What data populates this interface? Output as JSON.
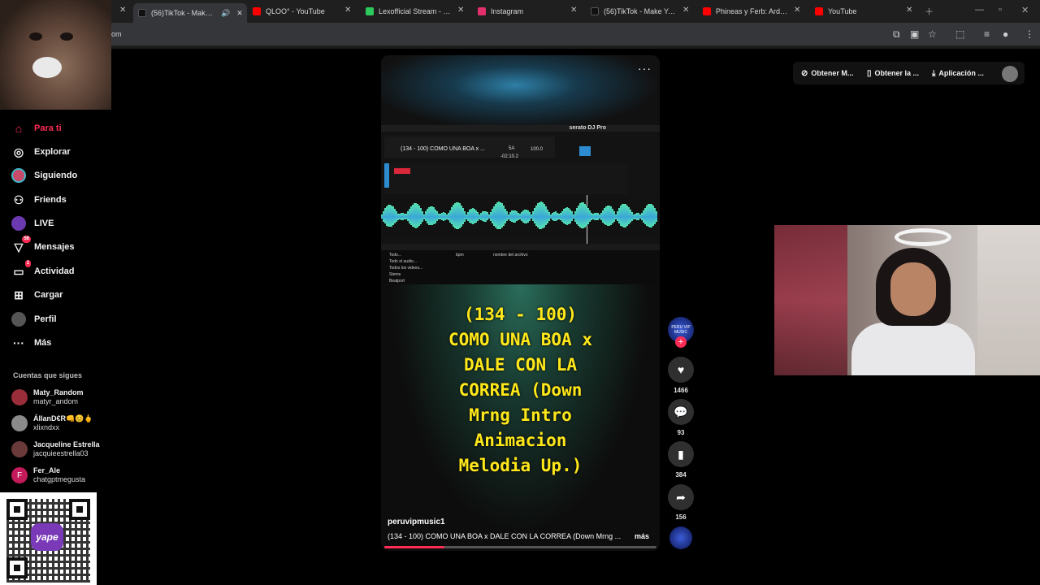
{
  "browser": {
    "tabs": [
      {
        "label": "(56)TikTok - Make You",
        "fav": "#111111",
        "active": true
      },
      {
        "label": "QLOO° - YouTube",
        "fav": "#ff0000"
      },
      {
        "label": "Lexofficial Stream - Watch",
        "fav": "#2ec95c"
      },
      {
        "label": "Instagram",
        "fav": "#e1306c"
      },
      {
        "label": "(56)TikTok - Make Your D",
        "fav": "#111111"
      },
      {
        "label": "Phineas y Ferb: Ardillas p",
        "fav": "#ff0000"
      },
      {
        "label": "YouTube",
        "fav": "#ff0000"
      }
    ],
    "url_fragment": "om"
  },
  "sidebar": {
    "items": [
      {
        "label": "Para ti",
        "icon": "home-icon",
        "glyph": "⌂"
      },
      {
        "label": "Explorar",
        "icon": "compass-icon",
        "glyph": "◎"
      },
      {
        "label": "Siguiendo",
        "icon": "following-avatar-icon",
        "glyph": ""
      },
      {
        "label": "Friends",
        "icon": "friends-icon",
        "glyph": "⚇"
      },
      {
        "label": "LIVE",
        "icon": "live-avatar-icon",
        "glyph": ""
      },
      {
        "label": "Mensajes",
        "icon": "messages-icon",
        "glyph": "✈",
        "badge": "56"
      },
      {
        "label": "Actividad",
        "icon": "activity-icon",
        "glyph": "▭",
        "badge": "1"
      },
      {
        "label": "Cargar",
        "icon": "upload-icon",
        "glyph": "⊞"
      },
      {
        "label": "Perfil",
        "icon": "profile-avatar-icon",
        "glyph": ""
      },
      {
        "label": "Más",
        "icon": "more-icon",
        "glyph": "···"
      }
    ],
    "following_title": "Cuentas que sigues",
    "following": [
      {
        "name": "Maty_Random",
        "user": "matyr_andom"
      },
      {
        "name": "ÁllanD€R👊😊🖕",
        "user": "xlixndxx"
      },
      {
        "name": "Jacqueline Estrella",
        "user": "jacquieestrella03"
      },
      {
        "name": "Fer_Ale",
        "user": "chatgptmegusta",
        "initial": "F"
      }
    ],
    "qr_logo": "yape"
  },
  "header": {
    "btn1": "Obtener M...",
    "btn2": "Obtener la ...",
    "btn3": "Aplicación ..."
  },
  "video": {
    "more": "···",
    "overlay_lines": [
      "(134 - 100)",
      "COMO UNA BOA x",
      "DALE CON LA",
      "CORREA (Down",
      "Mrng Intro",
      "Animacion",
      "Melodia Up.)"
    ],
    "author": "peruvipmusic1",
    "description": "(134 - 100) COMO UNA BOA x DALE CON LA CORREA (Down Mrng ...",
    "more_link": "más",
    "progress_percent": 22,
    "serato": {
      "brand": "serato DJ Pro",
      "track": "(134 - 100) COMO UNA BOA x ...",
      "key": "5A",
      "bpm": "100.0",
      "time": "-02:10.2",
      "library_items": [
        "Todo...",
        "Todo el audio...",
        "Todos los videos...",
        "Stems",
        "Beatport"
      ],
      "library_cols": [
        "bpm",
        "nombre del archivo"
      ]
    }
  },
  "actions": {
    "likes": "1466",
    "comments": "93",
    "saves": "384",
    "shares": "156",
    "avatar_text": "PERU VIP MUSIC"
  }
}
